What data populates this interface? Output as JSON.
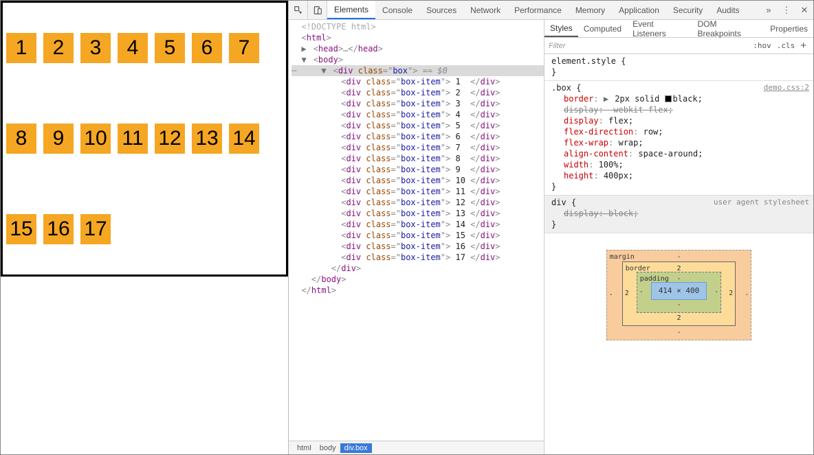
{
  "page": {
    "box_items": [
      "1",
      "2",
      "3",
      "4",
      "5",
      "6",
      "7",
      "8",
      "9",
      "10",
      "11",
      "12",
      "13",
      "14",
      "15",
      "16",
      "17"
    ]
  },
  "devtools": {
    "tabs": [
      "Elements",
      "Console",
      "Sources",
      "Network",
      "Performance",
      "Memory",
      "Application",
      "Security",
      "Audits"
    ],
    "active_tab": "Elements",
    "more_glyph": "»",
    "menu_glyph": "⋮",
    "close_glyph": "✕"
  },
  "dom": {
    "doctype": "<!DOCTYPE html>",
    "html_open": "<html>",
    "head_line": "<head>…</head>",
    "body_open": "<body>",
    "box_open_prefix": "<div class=\"",
    "box_open_class": "box",
    "box_open_suffix": "\">",
    "selected_marker": "== $0",
    "item_open_prefix": "<div class=\"",
    "item_class": "box-item",
    "item_open_suffix": "\"> ",
    "item_close": " </div>",
    "items": [
      "1",
      "2",
      "3",
      "4",
      "5",
      "6",
      "7",
      "8",
      "9",
      "10",
      "11",
      "12",
      "13",
      "14",
      "15",
      "16",
      "17"
    ],
    "box_close": "</div>",
    "body_close": "</body>",
    "html_close": "</html>"
  },
  "crumbs": [
    "html",
    "body",
    "div.box"
  ],
  "styles": {
    "tabs": [
      "Styles",
      "Computed",
      "Event Listeners",
      "DOM Breakpoints",
      "Properties"
    ],
    "active_tab": "Styles",
    "filter_placeholder": "Filter",
    "hov": ":hov",
    "cls": ".cls",
    "plus": "+",
    "element_style_header": "element.style {",
    "close_brace": "}",
    "box_rule": {
      "selector": ".box {",
      "origin": "demo.css:2",
      "decls": [
        {
          "prop": "border",
          "val": "2px solid ",
          "swatch": true,
          "val2": "black;",
          "strike": false,
          "triangle": true
        },
        {
          "prop": "display",
          "val": "-webkit-flex;",
          "strike": true
        },
        {
          "prop": "display",
          "val": "flex;",
          "strike": false
        },
        {
          "prop": "flex-direction",
          "val": "row;",
          "strike": false
        },
        {
          "prop": "flex-wrap",
          "val": "wrap;",
          "strike": false
        },
        {
          "prop": "align-content",
          "val": "space-around;",
          "strike": false
        },
        {
          "prop": "width",
          "val": "100%;",
          "strike": false
        },
        {
          "prop": "height",
          "val": "400px;",
          "strike": false
        }
      ]
    },
    "ua_rule": {
      "selector": "div {",
      "origin": "user agent stylesheet",
      "decls": [
        {
          "prop": "display",
          "val": "block;",
          "strike": true
        }
      ]
    }
  },
  "box_model": {
    "margin_label": "margin",
    "border_label": "border",
    "padding_label": "padding",
    "margin_vals": {
      "top": "-",
      "right": "-",
      "bottom": "-",
      "left": "-"
    },
    "border_vals": {
      "top": "2",
      "right": "2",
      "bottom": "2",
      "left": "2"
    },
    "padding_vals": {
      "top": "-",
      "right": "-",
      "bottom": "-",
      "left": "-"
    },
    "content": "414 × 400"
  }
}
